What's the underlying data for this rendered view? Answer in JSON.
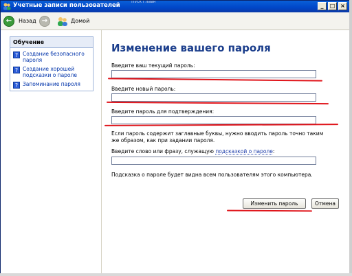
{
  "window": {
    "title": "Учетные записи пользователей",
    "behind_text": "Пуск   Главн"
  },
  "toolbar": {
    "back_label": "Назад",
    "home_label": "Домой"
  },
  "sidebar": {
    "heading": "Обучение",
    "items": [
      {
        "label": "Создание безопасного пароля"
      },
      {
        "label": "Создание хорошей подсказки о пароле"
      },
      {
        "label": "Запоминание пароля"
      }
    ]
  },
  "main": {
    "title": "Изменение вашего пароля",
    "current_label": "Введите ваш текущий пароль:",
    "new_label": "Введите новый пароль:",
    "confirm_label": "Введите пароль для подтверждения:",
    "caps_note": "Если пароль содержит заглавные буквы, нужно вводить пароль точно таким же образом, как при задании пароля.",
    "hint_prefix": "Введите слово или фразу, служащую ",
    "hint_link": "подсказкой о пароле",
    "hint_suffix": ":",
    "hint_visibility": "Подсказка о пароле будет видна всем пользователям этого компьютера.",
    "change_button": "Изменить пароль",
    "cancel_button": "Отмена"
  },
  "annotation_color": "#e0151b"
}
